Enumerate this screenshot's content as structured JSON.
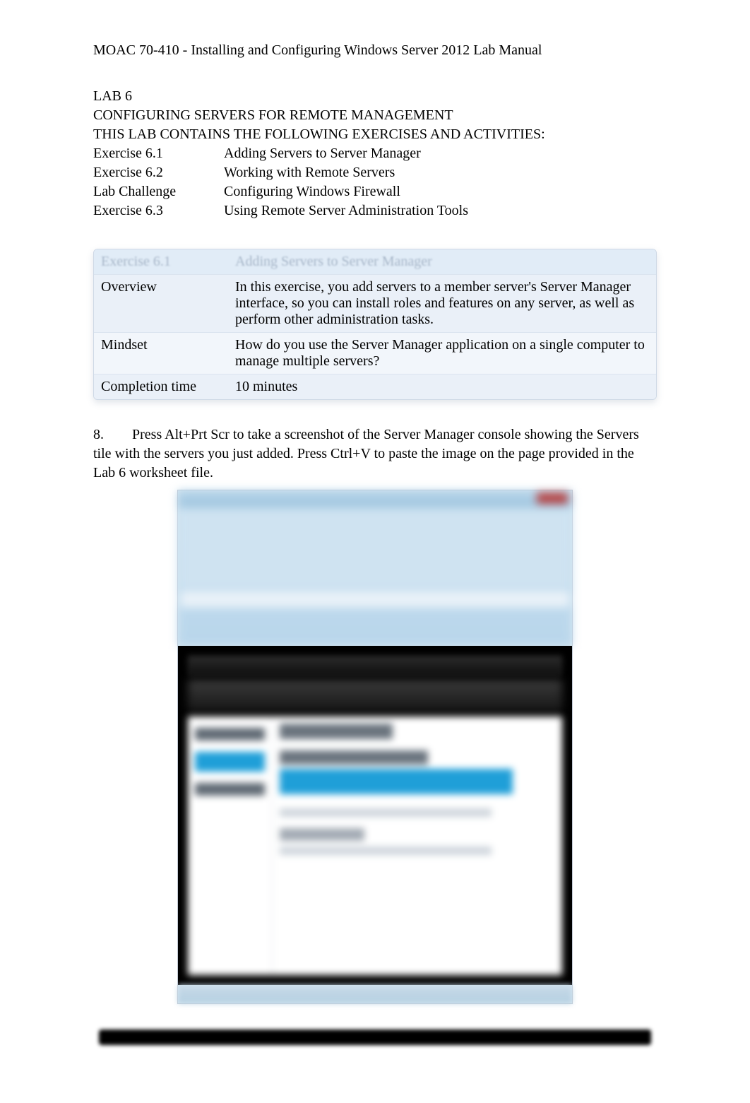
{
  "header_line": "MOAC 70-410 - Installing and Configuring Windows Server 2012 Lab Manual",
  "lab": {
    "number": "LAB 6",
    "title": "CONFIGURING SERVERS FOR REMOTE MANAGEMENT",
    "intro": "THIS LAB CONTAINS THE FOLLOWING EXERCISES AND ACTIVITIES:",
    "rows": [
      {
        "c1": "Exercise 6.1",
        "c2": "Adding Servers to Server Manager"
      },
      {
        "c1": "Exercise 6.2",
        "c2": "Working with Remote Servers"
      },
      {
        "c1": "Lab Challenge",
        "c2": "Configuring Windows Firewall"
      },
      {
        "c1": "Exercise 6.3",
        "c2": "Using Remote Server Administration Tools"
      }
    ]
  },
  "ex_table": {
    "header_ghost_c1": "Exercise 6.1",
    "header_ghost_c2": "Adding Servers to Server Manager",
    "rows": [
      {
        "c1": "Overview",
        "c2": "In this exercise, you add servers to a member server's Server Manager interface, so you can install roles and features on any server, as well as perform other administration tasks."
      },
      {
        "c1": "Mindset",
        "c2": "How do you use the Server Manager application on a single computer to manage multiple servers?"
      },
      {
        "c1": "Completion time",
        "c2": "10 minutes"
      }
    ]
  },
  "step": {
    "num": "8.",
    "text": "Press Alt+Prt Scr to take a screenshot of the Server Manager console showing the Servers tile with the servers you just added. Press Ctrl+V to paste the image on the page provided in the Lab 6 worksheet file."
  }
}
